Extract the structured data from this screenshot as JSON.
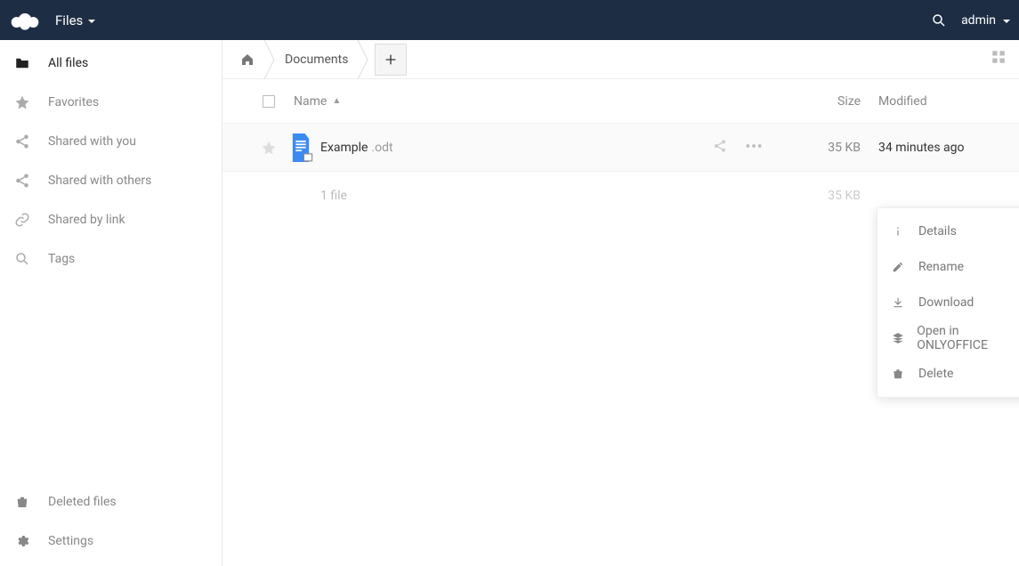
{
  "header": {
    "app_label": "Files",
    "user_label": "admin"
  },
  "sidebar": {
    "items": [
      {
        "label": "All files"
      },
      {
        "label": "Favorites"
      },
      {
        "label": "Shared with you"
      },
      {
        "label": "Shared with others"
      },
      {
        "label": "Shared by link"
      },
      {
        "label": "Tags"
      }
    ],
    "bottom": [
      {
        "label": "Deleted files"
      },
      {
        "label": "Settings"
      }
    ]
  },
  "breadcrumb": {
    "current": "Documents"
  },
  "columns": {
    "name": "Name",
    "size": "Size",
    "modified": "Modified"
  },
  "files": [
    {
      "name_base": "Example",
      "name_ext": ".odt",
      "size": "35 KB",
      "modified": "34 minutes ago"
    }
  ],
  "summary": {
    "count_label": "1 file",
    "total_size": "35 KB"
  },
  "context_menu": {
    "items": [
      {
        "label": "Details"
      },
      {
        "label": "Rename"
      },
      {
        "label": "Download"
      },
      {
        "label": "Open in ONLYOFFICE"
      },
      {
        "label": "Delete"
      }
    ]
  }
}
